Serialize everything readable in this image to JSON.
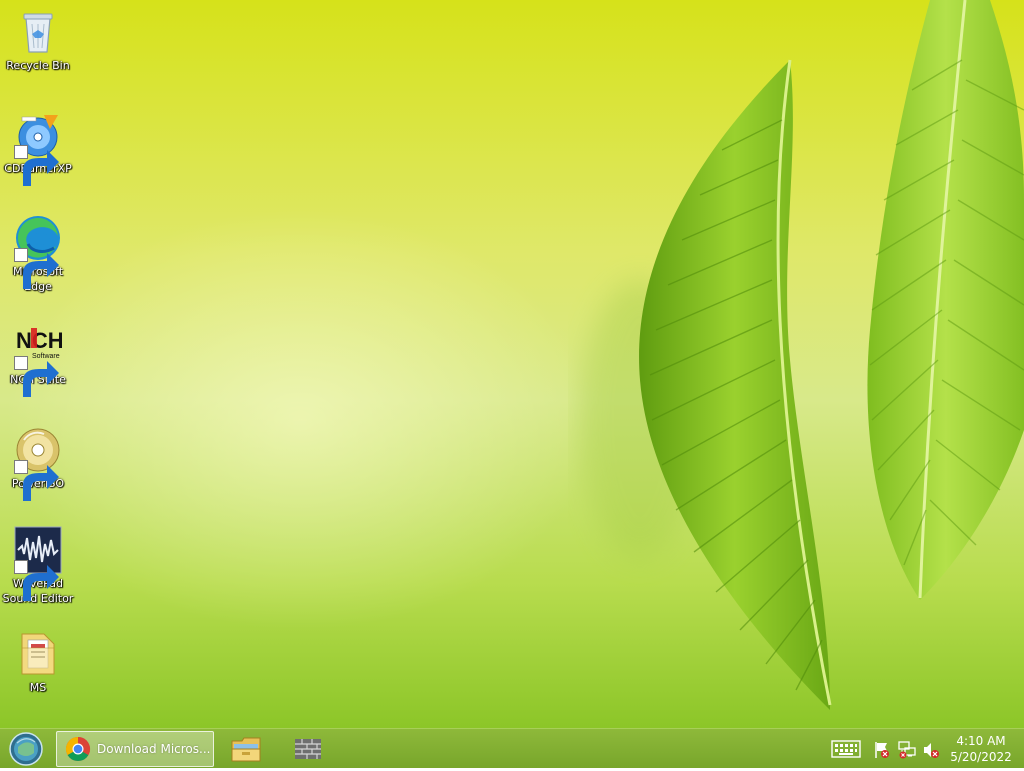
{
  "desktop": {
    "icons": [
      {
        "label": "Recycle Bin",
        "icon": "recycle-bin-icon"
      },
      {
        "label": "CDBurnerXP",
        "icon": "cdburnerxp-icon"
      },
      {
        "label": "Microsoft\nEdge",
        "icon": "microsoft-edge-icon"
      },
      {
        "label": "NCH Suite",
        "icon": "nch-suite-icon"
      },
      {
        "label": "PowerISO",
        "icon": "poweriso-icon"
      },
      {
        "label": "WavePad\nSound Editor",
        "icon": "wavepad-icon"
      },
      {
        "label": "MS",
        "icon": "folder-icon"
      }
    ],
    "nch_logo_text": "NCH",
    "nch_logo_subtext": "Software"
  },
  "taskbar": {
    "start_icon": "windows-start-orb-icon",
    "tasks": [
      {
        "title": "Download Micros...",
        "icon": "chrome-icon"
      },
      {
        "icon": "file-explorer-icon"
      },
      {
        "icon": "firewall-app-icon"
      }
    ],
    "tray": {
      "icons": [
        "keyboard-icon",
        "action-center-flag-icon",
        "network-icon",
        "volume-muted-icon"
      ],
      "time": "4:10 AM",
      "date": "5/20/2022"
    }
  },
  "colors": {
    "taskbar": "#7fae30",
    "wallpaper_top": "#d6e21a",
    "wallpaper_bottom": "#8cc628"
  }
}
